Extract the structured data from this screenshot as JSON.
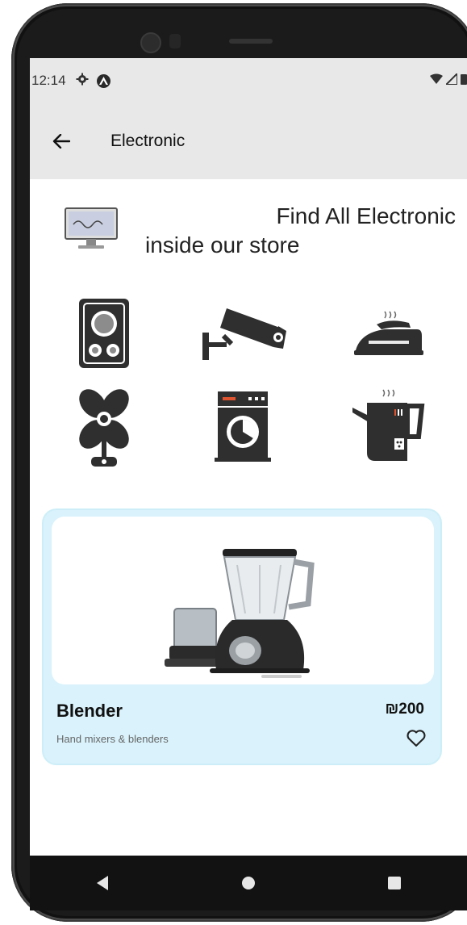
{
  "status_bar": {
    "time": "12:14",
    "icons": [
      "gear-icon",
      "a-badge-icon",
      "wifi-icon",
      "signal-icon",
      "battery-icon"
    ]
  },
  "app_bar": {
    "title": "Electronic",
    "back_icon": "arrow-left-icon"
  },
  "hero": {
    "line1": "Find All Electronic",
    "line2": "inside our store",
    "image_icon": "monitor-icon"
  },
  "categories": [
    {
      "icon": "speaker-icon"
    },
    {
      "icon": "security-camera-icon"
    },
    {
      "icon": "iron-icon"
    },
    {
      "icon": "fan-icon"
    },
    {
      "icon": "washing-machine-icon"
    },
    {
      "icon": "kettle-icon"
    }
  ],
  "product": {
    "name": "Blender",
    "price": "₪200",
    "subtitle": "Hand mixers & blenders",
    "favorite_icon": "heart-outline-icon",
    "image": "blender-image"
  },
  "nav_bar": {
    "buttons": [
      "back-triangle-icon",
      "home-circle-icon",
      "recents-square-icon"
    ]
  },
  "colors": {
    "app_bar": "#e8e8e8",
    "card_bg": "#d9f2fb",
    "nav_bar": "#121212",
    "icon_dark": "#2f2f2f"
  }
}
